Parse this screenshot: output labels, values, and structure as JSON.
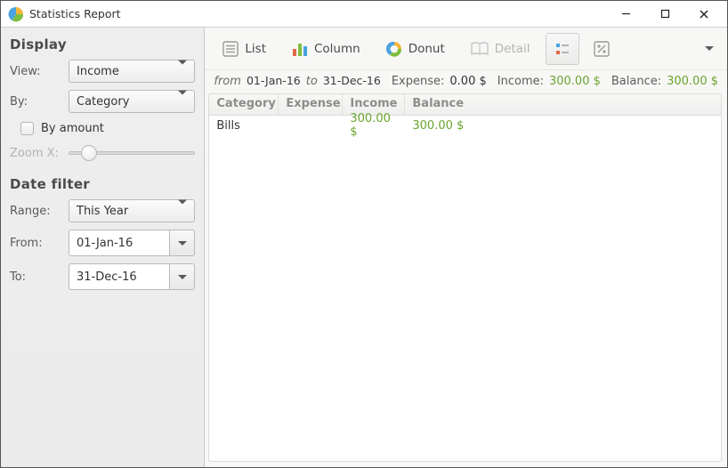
{
  "window": {
    "title": "Statistics Report"
  },
  "sidebar": {
    "display_title": "Display",
    "view_label": "View:",
    "view_value": "Income",
    "by_label": "By:",
    "by_value": "Category",
    "by_amount_label": "By amount",
    "zoom_label": "Zoom X:",
    "datefilter_title": "Date filter",
    "range_label": "Range:",
    "range_value": "This Year",
    "from_label": "From:",
    "from_value": "01-Jan-16",
    "to_label": "To:",
    "to_value": "31-Dec-16"
  },
  "toolbar": {
    "list": "List",
    "column": "Column",
    "donut": "Donut",
    "detail": "Detail"
  },
  "summary": {
    "from_word": "from",
    "from_date": "01-Jan-16",
    "to_word": "to",
    "to_date": "31-Dec-16",
    "expense_label": "Expense:",
    "expense_value": "0.00 $",
    "income_label": "Income:",
    "income_value": "300.00 $",
    "balance_label": "Balance:",
    "balance_value": "300.00 $"
  },
  "table": {
    "headers": {
      "category": "Category",
      "expense": "Expense",
      "income": "Income",
      "balance": "Balance"
    },
    "rows": [
      {
        "category": "Bills",
        "expense": "",
        "income": "300.00 $",
        "balance": "300.00 $"
      }
    ]
  }
}
